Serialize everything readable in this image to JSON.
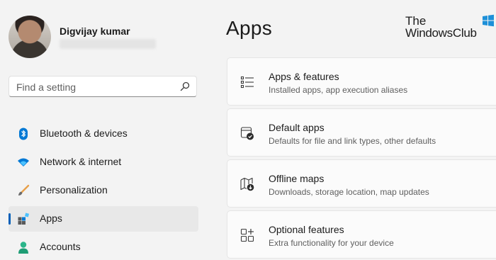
{
  "user": {
    "name": "Digvijay kumar"
  },
  "search": {
    "placeholder": "Find a setting"
  },
  "nav": {
    "items": [
      {
        "label": "Bluetooth & devices",
        "icon": "bluetooth-icon"
      },
      {
        "label": "Network & internet",
        "icon": "wifi-icon"
      },
      {
        "label": "Personalization",
        "icon": "brush-icon"
      },
      {
        "label": "Apps",
        "icon": "apps-icon",
        "selected": true
      },
      {
        "label": "Accounts",
        "icon": "person-icon"
      }
    ]
  },
  "main": {
    "title": "Apps",
    "cards": [
      {
        "title": "Apps & features",
        "subtitle": "Installed apps, app execution aliases",
        "icon": "list-icon"
      },
      {
        "title": "Default apps",
        "subtitle": "Defaults for file and link types, other defaults",
        "icon": "default-apps-icon"
      },
      {
        "title": "Offline maps",
        "subtitle": "Downloads, storage location, map updates",
        "icon": "map-download-icon"
      },
      {
        "title": "Optional features",
        "subtitle": "Extra functionality for your device",
        "icon": "add-features-icon"
      }
    ]
  },
  "watermark": {
    "line1": "The",
    "line2": "WindowsClub"
  },
  "colors": {
    "accent": "#005fb8",
    "background": "#f3f3f3",
    "card": "#fbfbfb"
  }
}
